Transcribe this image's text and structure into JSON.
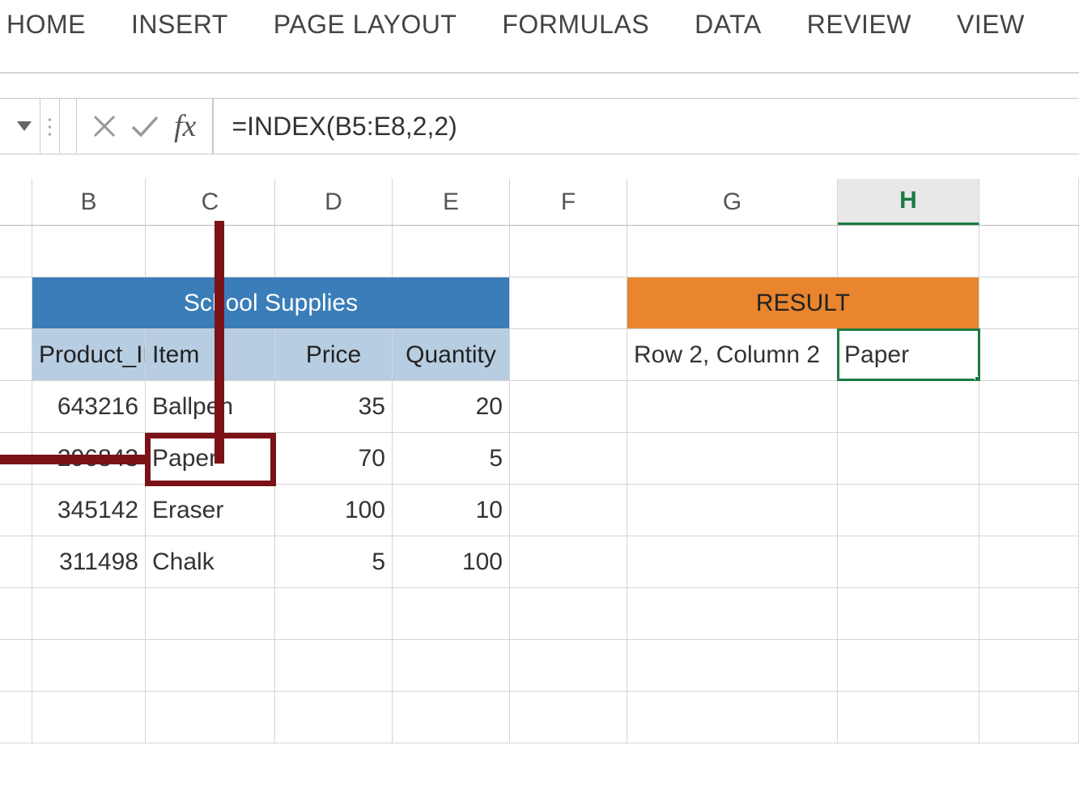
{
  "ribbon": {
    "tabs": [
      "HOME",
      "INSERT",
      "PAGE LAYOUT",
      "FORMULAS",
      "DATA",
      "REVIEW",
      "VIEW"
    ]
  },
  "formula_bar": {
    "fx_label": "fx",
    "formula": "=INDEX(B5:E8,2,2)"
  },
  "columns": [
    "B",
    "C",
    "D",
    "E",
    "F",
    "G",
    "H"
  ],
  "selected_column": "H",
  "data_table": {
    "title": "School Supplies",
    "headers": [
      "Product_ID",
      "Item",
      "Price",
      "Quantity"
    ],
    "rows": [
      {
        "product_id": "643216",
        "item": "Ballpen",
        "price": "35",
        "quantity": "20"
      },
      {
        "product_id": "296843",
        "item": "Paper",
        "price": "70",
        "quantity": "5"
      },
      {
        "product_id": "345142",
        "item": "Eraser",
        "price": "100",
        "quantity": "10"
      },
      {
        "product_id": "311498",
        "item": "Chalk",
        "price": "5",
        "quantity": "100"
      }
    ]
  },
  "result_table": {
    "title": "RESULT",
    "label": "Row 2, Column 2",
    "value": "Paper"
  },
  "annotation": {
    "highlighted_cell": "Paper"
  }
}
